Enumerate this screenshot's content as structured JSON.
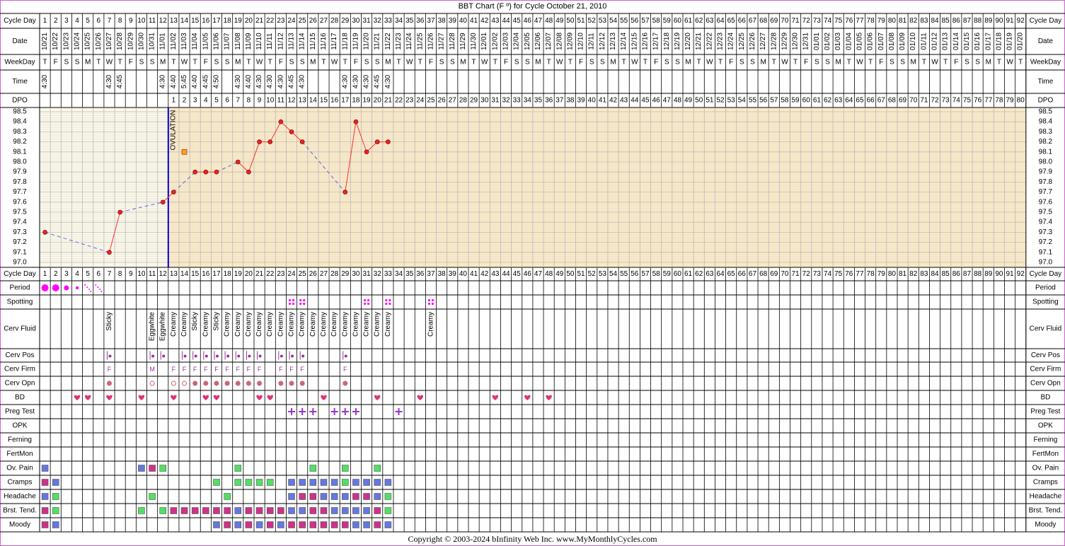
{
  "title": "BBT Chart (F º) for Cycle October 21, 2010",
  "copyright": "Copyright © 2003-2024 bInfinity Web Inc.     www.MyMonthlyCycles.com",
  "ovulation_label": "OVULATION",
  "ovulation_day": 12,
  "row_labels": {
    "cycle_day": "Cycle Day",
    "date": "Date",
    "weekday": "WeekDay",
    "time": "Time",
    "dpo": "DPO",
    "period": "Period",
    "spotting": "Spotting",
    "cerv_fluid": "Cerv Fluid",
    "cerv_pos": "Cerv Pos",
    "cerv_firm": "Cerv Firm",
    "cerv_opn": "Cerv Opn",
    "bd": "BD",
    "preg_test": "Preg Test",
    "opk": "OPK",
    "ferning": "Ferning",
    "fertmon": "FertMon",
    "ov_pain": "Ov. Pain",
    "cramps": "Cramps",
    "headache": "Headache",
    "brst_tend": "Brst. Tend.",
    "moody": "Moody"
  },
  "temp_ticks": [
    "98.5",
    "98.4",
    "98.3",
    "98.2",
    "98.1",
    "98.0",
    "97.9",
    "97.8",
    "97.7",
    "97.6",
    "97.5",
    "97.4",
    "97.3",
    "97.2",
    "97.1",
    "97.0"
  ],
  "dates": [
    "10/21",
    "10/22",
    "10/23",
    "10/24",
    "10/25",
    "10/26",
    "10/27",
    "10/28",
    "10/29",
    "10/30",
    "10/31",
    "11/01",
    "11/02",
    "11/03",
    "11/04",
    "11/05",
    "11/06",
    "11/07",
    "11/08",
    "11/09",
    "11/10",
    "11/11",
    "11/12",
    "11/13",
    "11/14",
    "11/15",
    "11/16",
    "11/17",
    "11/18",
    "11/19",
    "11/20",
    "11/21",
    "11/22",
    "11/23",
    "11/24",
    "11/25",
    "11/26",
    "11/27",
    "11/28",
    "11/29",
    "11/30",
    "12/01",
    "12/02",
    "12/03",
    "12/04",
    "12/05",
    "12/06",
    "12/07",
    "12/08",
    "12/09",
    "12/10",
    "12/11",
    "12/12",
    "12/13",
    "12/14",
    "12/15",
    "12/16",
    "12/17",
    "12/18",
    "12/19",
    "12/20",
    "12/21",
    "12/22",
    "12/23",
    "12/24",
    "12/25",
    "12/26",
    "12/27",
    "12/28",
    "12/29",
    "12/30",
    "12/31",
    "01/01",
    "01/02",
    "01/03",
    "01/04",
    "01/05",
    "01/06",
    "01/07",
    "01/08",
    "01/09",
    "01/10",
    "01/11",
    "01/12",
    "01/13",
    "01/14",
    "01/15",
    "01/16",
    "01/17",
    "01/18",
    "01/19",
    "01/20"
  ],
  "weekdays": [
    "T",
    "F",
    "S",
    "S",
    "M",
    "T",
    "W",
    "T",
    "F",
    "S",
    "S",
    "M",
    "T",
    "W",
    "T",
    "F",
    "S",
    "S",
    "M",
    "T",
    "W",
    "T",
    "F",
    "S",
    "S",
    "M",
    "T",
    "W",
    "T",
    "F",
    "S",
    "S",
    "M",
    "T",
    "W",
    "T",
    "F",
    "S",
    "S",
    "M",
    "T",
    "W",
    "T",
    "F",
    "S",
    "S",
    "M",
    "T",
    "W",
    "T",
    "F",
    "S",
    "S",
    "M",
    "T",
    "W",
    "T",
    "F",
    "S",
    "S",
    "M",
    "T",
    "W",
    "T",
    "F",
    "S",
    "S",
    "M",
    "T",
    "W",
    "T",
    "F",
    "S",
    "S",
    "M",
    "T",
    "W",
    "T",
    "F",
    "S",
    "S",
    "M",
    "T",
    "W",
    "T",
    "F",
    "S",
    "S",
    "M",
    "T",
    "W",
    "T"
  ],
  "times": [
    "4:30",
    "",
    "",
    "",
    "",
    "",
    "4:30",
    "4:45",
    "",
    "",
    "",
    "4:30",
    "4:40",
    "5:45",
    "4:40",
    "4:45",
    "4:50",
    "",
    "4:30",
    "4:40",
    "4:30",
    "4:30",
    "4:30",
    "4:45",
    "4:30",
    "",
    "",
    "",
    "4:30",
    "4:30",
    "4:30",
    "4:45",
    "4:30",
    "",
    "",
    "",
    "",
    "",
    "",
    "",
    "",
    "",
    "",
    "",
    "",
    "",
    "",
    "",
    "",
    "",
    "",
    "",
    "",
    "",
    "",
    "",
    "",
    "",
    "",
    "",
    "",
    "",
    "",
    "",
    "",
    "",
    "",
    "",
    "",
    "",
    "",
    "",
    "",
    "",
    "",
    "",
    "",
    "",
    "",
    "",
    "",
    "",
    "",
    "",
    "",
    "",
    "",
    "",
    "",
    "",
    ""
  ],
  "chart_data": {
    "type": "line",
    "title": "BBT Chart (F º) for Cycle October 21, 2010",
    "xlabel": "Cycle Day",
    "ylabel": "",
    "ylim": [
      97.0,
      98.5
    ],
    "x": [
      1,
      7,
      8,
      12,
      13,
      15,
      16,
      17,
      19,
      20,
      21,
      22,
      23,
      24,
      25,
      29,
      30,
      31,
      32,
      33
    ],
    "y": [
      97.3,
      97.1,
      97.5,
      97.6,
      97.7,
      97.9,
      97.9,
      97.9,
      98.0,
      97.9,
      98.2,
      98.2,
      98.4,
      98.3,
      98.2,
      97.7,
      98.4,
      98.1,
      98.2,
      98.2
    ],
    "excluded_points": [
      {
        "x": 14,
        "y": 98.1
      }
    ],
    "grid": true,
    "legend": "none"
  },
  "fluid": {
    "7": "Sticky",
    "11": "Eggwhite",
    "12": "Eggwhite",
    "13": "Creamy",
    "14": "Creamy",
    "15": "Sticky",
    "16": "Creamy",
    "17": "Sticky",
    "18": "Creamy",
    "19": "Creamy",
    "20": "Creamy",
    "21": "Creamy",
    "22": "Creamy",
    "23": "Creamy",
    "24": "Creamy",
    "25": "Creamy",
    "26": "Creamy",
    "27": "Creamy",
    "28": "Creamy",
    "29": "Creamy",
    "30": "Creamy",
    "31": "Creamy",
    "32": "Creamy",
    "33": "Creamy",
    "37": "Creamy"
  },
  "period": {
    "1": "heavy",
    "2": "heavy",
    "3": "medium",
    "4": "light",
    "5": "spot",
    "6": "spot"
  },
  "spotting_days": [
    24,
    25,
    31,
    33,
    37
  ],
  "cerv_pos_days": [
    7,
    11,
    12,
    14,
    15,
    16,
    17,
    18,
    19,
    20,
    21,
    23,
    24,
    25,
    29
  ],
  "cerv_firm": {
    "7": "F",
    "11": "M",
    "13": "F",
    "14": "F",
    "15": "F",
    "16": "F",
    "17": "F",
    "18": "F",
    "19": "F",
    "20": "F",
    "21": "F",
    "23": "F",
    "24": "F",
    "25": "F",
    "29": "F"
  },
  "cerv_open": {
    "7": "closed",
    "11": "open",
    "13": "open",
    "14": "open",
    "15": "closed",
    "16": "closed",
    "17": "closed",
    "18": "closed",
    "19": "closed",
    "20": "closed",
    "21": "closed",
    "23": "closed",
    "24": "closed",
    "25": "closed",
    "29": "closed"
  },
  "bd_days": [
    4,
    5,
    7,
    10,
    13,
    16,
    17,
    21,
    22,
    27,
    32,
    36,
    43,
    46,
    48
  ],
  "preg_test_days": [
    24,
    25,
    26,
    28,
    29,
    30,
    34
  ],
  "symptoms": {
    "ov_pain": {
      "1": "blue",
      "10": "blue",
      "11": "magenta",
      "12": "green",
      "19": "green",
      "26": "green",
      "29": "green",
      "32": "green"
    },
    "cramps": {
      "1": "magenta",
      "2": "blue",
      "17": "green",
      "19": "green",
      "20": "green",
      "21": "green",
      "22": "green",
      "24": "blue",
      "25": "blue",
      "26": "blue",
      "27": "blue",
      "28": "blue",
      "29": "green",
      "30": "blue",
      "31": "blue",
      "32": "blue",
      "33": "blue"
    },
    "headache": {
      "1": "blue",
      "2": "green",
      "11": "green",
      "18": "green",
      "24": "blue",
      "25": "magenta",
      "26": "magenta",
      "27": "blue",
      "28": "blue",
      "29": "blue",
      "30": "magenta",
      "31": "magenta",
      "32": "blue",
      "33": "green"
    },
    "brst_tend": {
      "1": "magenta",
      "2": "green",
      "10": "green",
      "12": "green",
      "13": "magenta",
      "14": "magenta",
      "15": "magenta",
      "16": "magenta",
      "17": "magenta",
      "18": "magenta",
      "19": "blue",
      "20": "magenta",
      "21": "magenta",
      "22": "magenta",
      "23": "magenta",
      "24": "blue",
      "25": "blue",
      "26": "magenta",
      "27": "magenta",
      "28": "blue",
      "29": "blue",
      "30": "blue",
      "31": "blue",
      "32": "magenta",
      "33": "green"
    },
    "moody": {
      "1": "magenta",
      "2": "blue",
      "17": "blue",
      "18": "magenta",
      "19": "blue",
      "20": "magenta",
      "21": "blue",
      "22": "magenta",
      "23": "blue",
      "24": "magenta",
      "25": "magenta",
      "26": "magenta",
      "27": "magenta",
      "28": "magenta",
      "29": "magenta",
      "30": "blue",
      "31": "blue",
      "32": "magenta",
      "33": "blue"
    }
  },
  "colors": {
    "page_border": "#cc66cc",
    "grid_line": "#b9b9b9",
    "pre_ov_fill": "#fcf8e8",
    "post_ov_fill": "#fbe9c4",
    "ovulation_line": "#0000cc",
    "temp_line": "#ff3333",
    "gap_line": "#5566dd",
    "point_fill": "#ee2222",
    "excluded_point": "#ff9933",
    "period": "#ff00ff",
    "heart": "#dd3377",
    "preg_plus": "#9933cc",
    "cerv_mark": "#993399",
    "cerv_open_fill": "#cc6677",
    "sym_blue": "#6677dd",
    "sym_magenta": "#cc3388",
    "sym_green": "#55dd66"
  }
}
